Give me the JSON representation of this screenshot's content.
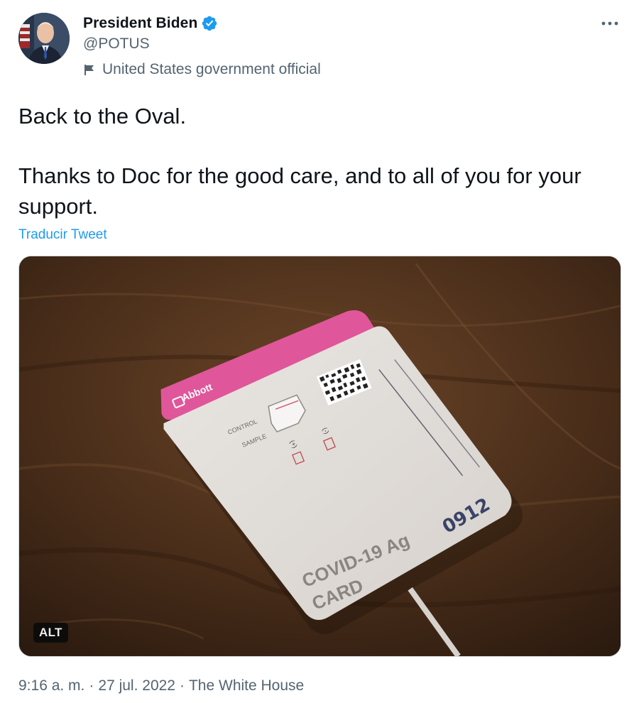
{
  "author": {
    "display_name": "President Biden",
    "handle": "@POTUS",
    "label": "United States government official",
    "verified": true
  },
  "tweet": {
    "line1": "Back to the Oval.",
    "line2": "Thanks to Doc for the good care, and to all of you for your support.",
    "translate_link": "Traducir Tweet"
  },
  "media": {
    "alt_badge": "ALT",
    "card_text": {
      "brand": "Abbott",
      "control": "CONTROL",
      "sample": "SAMPLE",
      "plus": "(+)",
      "minus": "(-)",
      "product": "COVID-19 Ag",
      "card": "CARD",
      "number": "0912"
    }
  },
  "meta": {
    "time": "9:16 a. m.",
    "date": "27 jul. 2022",
    "source": "The White House",
    "separator": "·"
  },
  "icons": {
    "verified": "verified-badge-icon",
    "flag": "flag-icon",
    "more": "more-options-icon"
  },
  "colors": {
    "link": "#1d9bf0",
    "secondary_text": "#536471",
    "primary_text": "#0f1419",
    "verified": "#1d9bf0"
  }
}
